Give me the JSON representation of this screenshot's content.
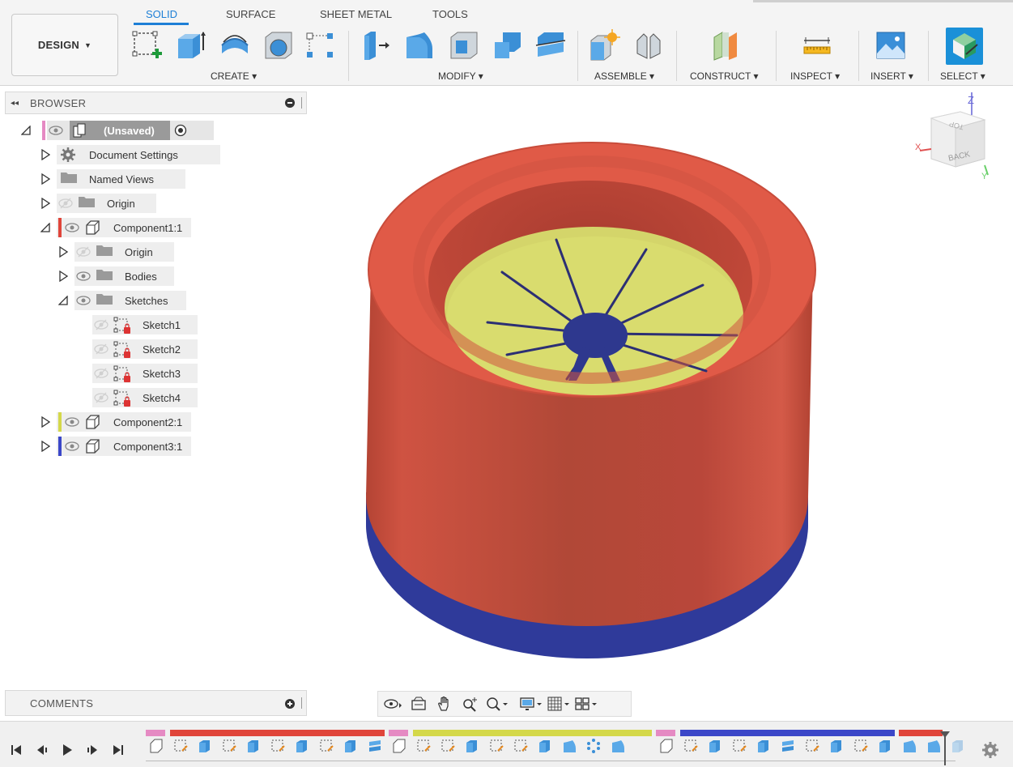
{
  "toolbar": {
    "workspace": "DESIGN",
    "tabs": [
      "SOLID",
      "SURFACE",
      "SHEET METAL",
      "TOOLS"
    ],
    "groups": [
      "CREATE",
      "MODIFY",
      "ASSEMBLE",
      "CONSTRUCT",
      "INSPECT",
      "INSERT",
      "SELECT"
    ]
  },
  "browser": {
    "title": "BROWSER",
    "root": "(Unsaved)",
    "items": [
      {
        "label": "Document Settings",
        "icon": "gear-icon"
      },
      {
        "label": "Named Views",
        "icon": "folder-icon"
      },
      {
        "label": "Origin",
        "icon": "folder-icon"
      },
      {
        "label": "Component1:1",
        "icon": "component-icon",
        "color": "#e0453a"
      },
      {
        "label": "Origin",
        "icon": "folder-icon"
      },
      {
        "label": "Bodies",
        "icon": "folder-icon"
      },
      {
        "label": "Sketches",
        "icon": "folder-icon"
      },
      {
        "label": "Sketch1",
        "icon": "sketch-icon"
      },
      {
        "label": "Sketch2",
        "icon": "sketch-icon"
      },
      {
        "label": "Sketch3",
        "icon": "sketch-icon"
      },
      {
        "label": "Sketch4",
        "icon": "sketch-icon"
      },
      {
        "label": "Component2:1",
        "icon": "component-icon",
        "color": "#d4d84a"
      },
      {
        "label": "Component3:1",
        "icon": "component-icon",
        "color": "#3b47c8"
      }
    ]
  },
  "comments": {
    "title": "COMMENTS"
  },
  "viewcube": {
    "top": "TOP",
    "back": "BACK",
    "z": "Z",
    "x": "X",
    "y": "Y"
  },
  "colors": {
    "accent": "#1e7fd6",
    "cylinder": "#de5846",
    "insert": "#d9dc6e",
    "base": "#2f3a9a",
    "root_tag": "#e58ac3"
  }
}
